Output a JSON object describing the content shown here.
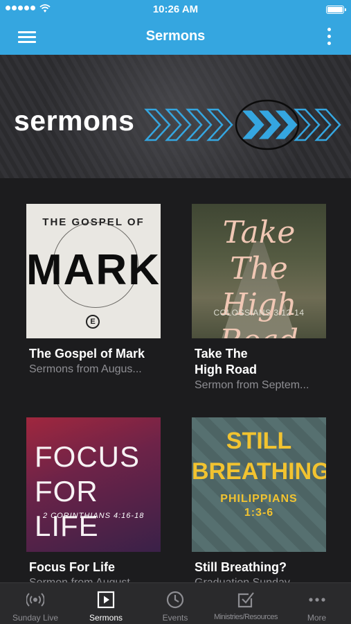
{
  "status_bar": {
    "time": "10:26 AM"
  },
  "nav": {
    "title": "Sermons"
  },
  "banner": {
    "title": "sermons"
  },
  "cards": [
    {
      "art_lines": [
        "THE GOSPEL OF",
        "MARK"
      ],
      "art_logo": "E",
      "title": "The Gospel of Mark",
      "subtitle": "Sermons from Augus..."
    },
    {
      "art_lines": [
        "Take The",
        "High Road",
        "COLOSSIANS 3:12-14"
      ],
      "title": "Take The High Road",
      "subtitle": "Sermon from Septem..."
    },
    {
      "art_lines": [
        "FOCUS",
        "FOR LIFE",
        "2 CORINTHIANS 4:16-18"
      ],
      "title": "Focus For Life",
      "subtitle": "Sermon from August..."
    },
    {
      "art_lines": [
        "STILL",
        "BREATHING?",
        "PHILIPPIANS",
        "1:3-6"
      ],
      "title": "Still Breathing?",
      "subtitle": "Graduation Sunday -..."
    }
  ],
  "tabs": [
    {
      "label": "Sunday Live",
      "icon": "broadcast-icon",
      "active": false
    },
    {
      "label": "Sermons",
      "icon": "play-icon",
      "active": true
    },
    {
      "label": "Events",
      "icon": "clock-icon",
      "active": false
    },
    {
      "label": "Ministries/Resources",
      "icon": "checkbox-icon",
      "active": false
    },
    {
      "label": "More",
      "icon": "ellipsis-icon",
      "active": false
    }
  ],
  "colors": {
    "accent": "#35a6e0",
    "background": "#1c1c1e",
    "tab_bar": "#2a2a2c"
  }
}
